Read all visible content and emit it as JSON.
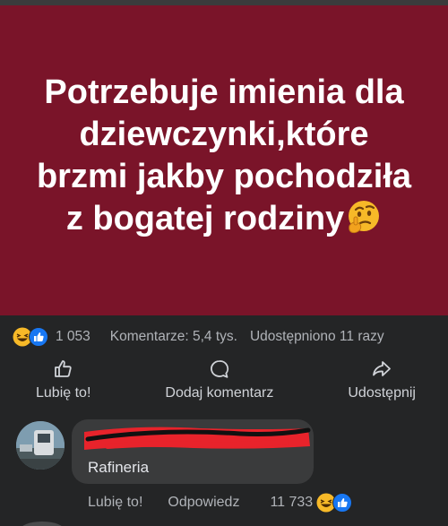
{
  "post": {
    "text": "Potrzebuje imienia dla dziewczynki,które brzmi jakby pochodziła z bogatej rodziny",
    "emoji": "thinking-face-emoji",
    "background_color": "#7a1429"
  },
  "stats": {
    "reaction_count": "1 053",
    "comments": "Komentarze: 5,4 tys.",
    "shares": "Udostępniono 11 razy",
    "reaction_icons": [
      "haha-icon",
      "like-icon"
    ]
  },
  "actions": {
    "like": "Lubię to!",
    "comment": "Dodaj komentarz",
    "share": "Udostępnij"
  },
  "comment": {
    "author_redacted": true,
    "text": "Rafineria",
    "like_label": "Lubię to!",
    "reply_label": "Odpowiedz",
    "reaction_count": "11 733",
    "reaction_icons": [
      "haha-icon",
      "like-icon"
    ]
  },
  "colors": {
    "background": "#242526",
    "bubble": "#3a3b3c",
    "like_blue": "#1877f2",
    "haha_yellow": "#f7b928",
    "redaction_red": "#e8232b"
  }
}
